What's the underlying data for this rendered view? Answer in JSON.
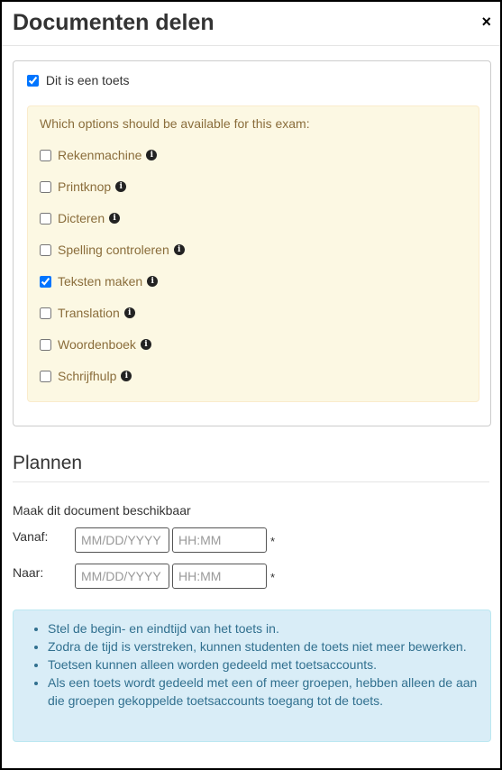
{
  "dialog": {
    "title": "Documenten delen",
    "close_symbol": "×"
  },
  "exam": {
    "checkbox_label": "Dit is een toets",
    "checked": true,
    "question": "Which options should be available for this exam:",
    "options": [
      {
        "label": "Rekenmachine",
        "checked": false
      },
      {
        "label": "Printknop",
        "checked": false
      },
      {
        "label": "Dicteren",
        "checked": false
      },
      {
        "label": "Spelling controleren",
        "checked": false
      },
      {
        "label": "Teksten maken",
        "checked": true
      },
      {
        "label": "Translation",
        "checked": false
      },
      {
        "label": "Woordenboek",
        "checked": false
      },
      {
        "label": "Schrijfhulp",
        "checked": false
      }
    ]
  },
  "schedule": {
    "heading": "Plannen",
    "available_text": "Maak dit document beschikbaar",
    "from_label": "Vanaf:",
    "to_label": "Naar:",
    "date_placeholder": "MM/DD/YYYY",
    "time_placeholder": "HH:MM",
    "required_mark": "*"
  },
  "info": {
    "items": [
      "Stel de begin- en eindtijd van het toets in.",
      "Zodra de tijd is verstreken, kunnen studenten de toets niet meer bewerken.",
      "Toetsen kunnen alleen worden gedeeld met toetsaccounts.",
      "Als een toets wordt gedeeld met een of meer groepen, hebben alleen de aan die groepen gekoppelde toetsaccounts toegang tot de toets."
    ]
  }
}
